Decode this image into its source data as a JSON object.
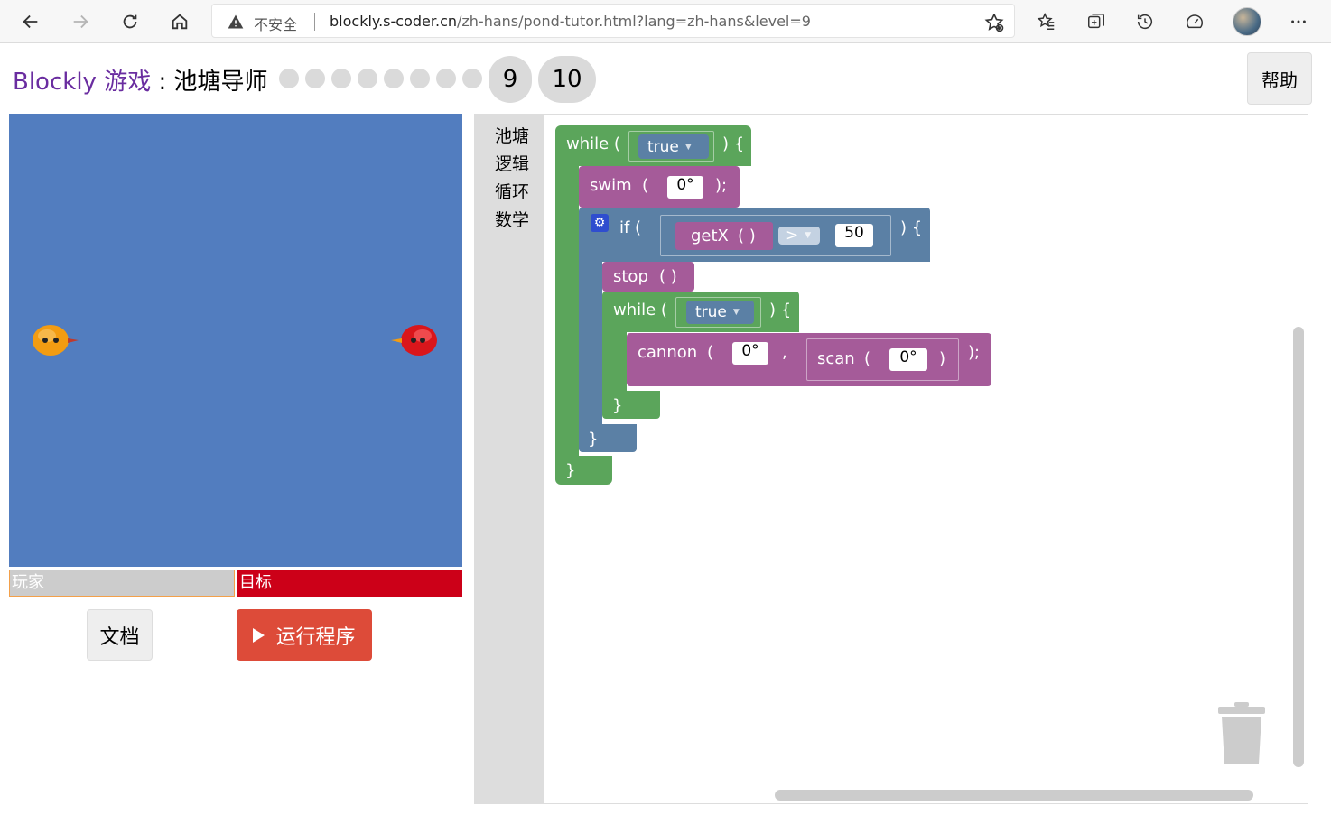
{
  "browser": {
    "insecure_label": "不安全",
    "url_host": "blockly.s-coder.cn",
    "url_path": "/zh-hans/pond-tutor.html?lang=zh-hans&level=9"
  },
  "header": {
    "brand": "Blockly 游戏",
    "separator": " : ",
    "title": "池塘导师",
    "levels": [
      "9",
      "10"
    ],
    "help_label": "帮助"
  },
  "game": {
    "player_label": "玩家",
    "target_label": "目标",
    "docs_label": "文档",
    "run_label": "运行程序"
  },
  "toolbox": {
    "categories": [
      "池塘",
      "逻辑",
      "循环",
      "数学"
    ]
  },
  "blocks": {
    "while1_kw": "while (",
    "while1_end": ") {",
    "while1_cond": "true",
    "swim_kw": "swim",
    "swim_open": "(",
    "swim_arg": "0°",
    "swim_end": ");",
    "if_kw": "if (",
    "if_end": ") {",
    "getx_kw": "getX",
    "getx_parens": "( )",
    "compare_op": ">",
    "compare_val": "50",
    "stop_kw": "stop",
    "stop_parens": "( )",
    "while2_kw": "while (",
    "while2_end": ") {",
    "while2_cond": "true",
    "cannon_kw": "cannon",
    "cannon_open": "(",
    "cannon_arg": "0°",
    "cannon_comma": ",",
    "scan_kw": "scan",
    "scan_open": "(",
    "scan_arg": "0°",
    "scan_close": ")",
    "cannon_end": ");",
    "close_brace": "}"
  }
}
